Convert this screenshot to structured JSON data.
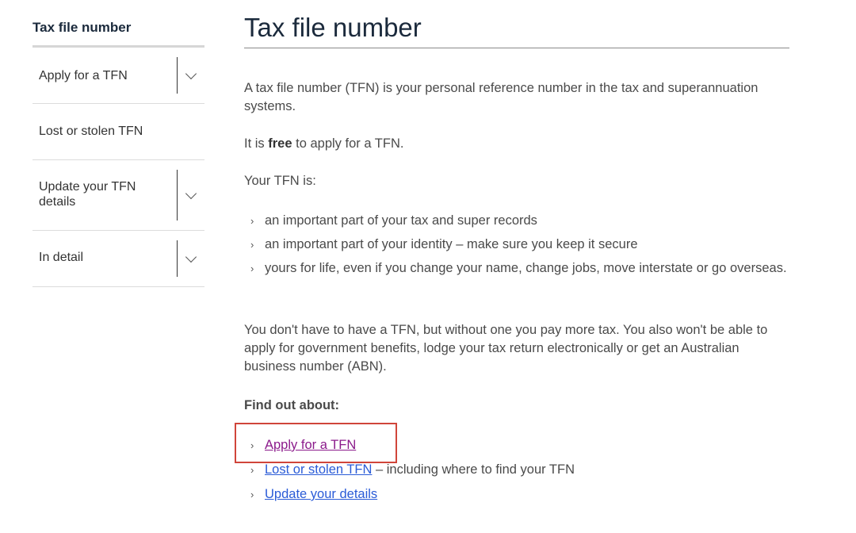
{
  "sidebar": {
    "title": "Tax file number",
    "items": [
      {
        "label": "Apply for a TFN",
        "has_toggle": true
      },
      {
        "label": "Lost or stolen TFN",
        "has_toggle": false
      },
      {
        "label": "Update your TFN details",
        "has_toggle": true
      },
      {
        "label": "In detail",
        "has_toggle": true
      }
    ]
  },
  "main": {
    "title": "Tax file number",
    "intro": "A tax file number (TFN) is your personal reference number in the tax and superannuation systems.",
    "free_before": "It is ",
    "free_bold": "free",
    "free_after": " to apply for a TFN.",
    "your_tfn_is": "Your TFN is:",
    "bullets": [
      "an important part of your tax and super records",
      "an important part of your identity – make sure you keep it secure",
      "yours for life, even if you change your name, change jobs, move interstate or go overseas."
    ],
    "dont_have": "You don't have to have a TFN, but without one you pay more tax. You also won't be able to apply for government benefits, lodge your tax return electronically or get an Australian business number (ABN).",
    "find_out": "Find out about:",
    "links": [
      {
        "text": "Apply for a TFN",
        "suffix": ""
      },
      {
        "text": "Lost or stolen TFN",
        "suffix": " – including where to find your TFN"
      },
      {
        "text": "Update your details",
        "suffix": ""
      }
    ]
  },
  "colors": {
    "link": "#2a5bd7",
    "visited_link": "#8b1a8b",
    "highlight": "#d0453a"
  }
}
